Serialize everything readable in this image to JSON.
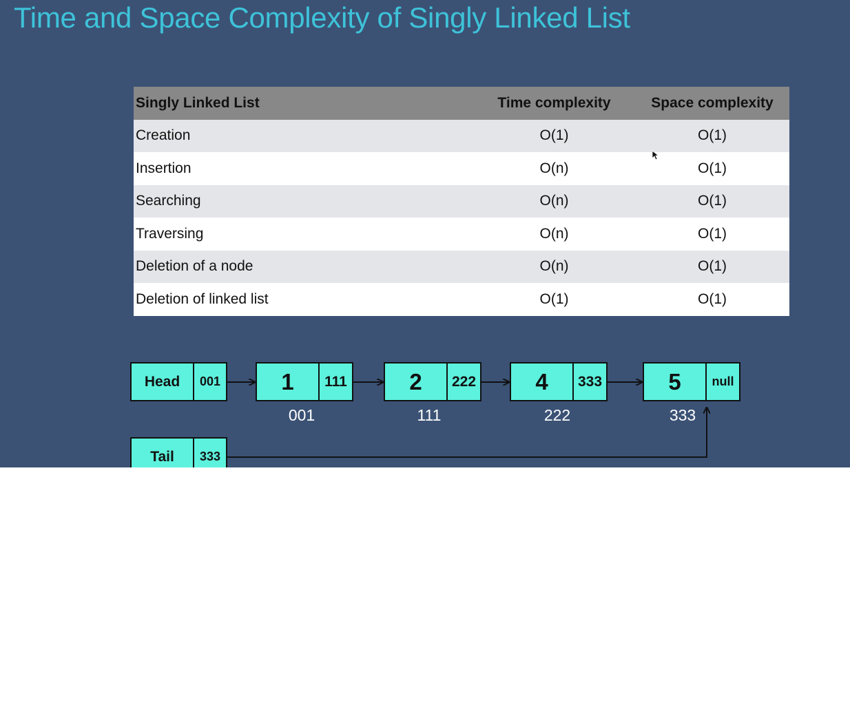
{
  "title": "Time and Space Complexity of Singly Linked List",
  "table": {
    "headers": [
      "Singly Linked List",
      "Time complexity",
      "Space complexity"
    ],
    "rows": [
      {
        "operation": "Creation",
        "time": "O(1)",
        "space": "O(1)"
      },
      {
        "operation": "Insertion",
        "time": "O(n)",
        "space": "O(1)"
      },
      {
        "operation": "Searching",
        "time": "O(n)",
        "space": "O(1)"
      },
      {
        "operation": "Traversing",
        "time": "O(n)",
        "space": "O(1)"
      },
      {
        "operation": "Deletion of a node",
        "time": "O(n)",
        "space": "O(1)"
      },
      {
        "operation": "Deletion of linked list",
        "time": "O(1)",
        "space": "O(1)"
      }
    ]
  },
  "diagram": {
    "head": {
      "label": "Head",
      "pointer": "001"
    },
    "tail": {
      "label": "Tail",
      "pointer": "333"
    },
    "nodes": [
      {
        "value": "1",
        "next": "111",
        "address": "001"
      },
      {
        "value": "2",
        "next": "222",
        "address": "111"
      },
      {
        "value": "4",
        "next": "333",
        "address": "222"
      },
      {
        "value": "5",
        "next": "null",
        "address": "333"
      }
    ]
  },
  "colors": {
    "background": "#3b5275",
    "title": "#3ec3d9",
    "node_fill": "#5cf2dd",
    "table_header": "#888888",
    "table_row_alt": "#e4e5e9"
  }
}
